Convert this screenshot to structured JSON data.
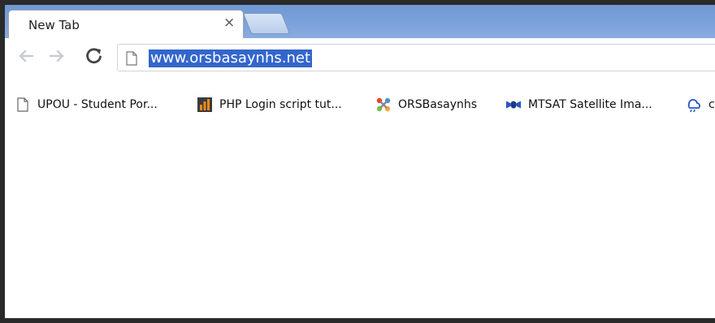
{
  "tab": {
    "title": "New Tab",
    "close_glyph": "×"
  },
  "toolbar": {
    "back_icon": "back-arrow-icon",
    "forward_icon": "forward-arrow-icon",
    "reload_icon": "reload-icon"
  },
  "omnibox": {
    "url": "www.orsbasaynhs.net",
    "selection_color": "#3366cc"
  },
  "bookmarks": [
    {
      "label": "UPOU - Student Por...",
      "icon": "page-icon"
    },
    {
      "label": "PHP Login script tut...",
      "icon": "bar-chart-icon"
    },
    {
      "label": "ORSBasaynhs",
      "icon": "joomla-icon"
    },
    {
      "label": "MTSAT Satellite Ima...",
      "icon": "satellite-icon"
    },
    {
      "label": "c",
      "icon": "weather-icon"
    }
  ],
  "colors": {
    "tabstrip": "#6f97d4",
    "accent": "#3366cc"
  }
}
